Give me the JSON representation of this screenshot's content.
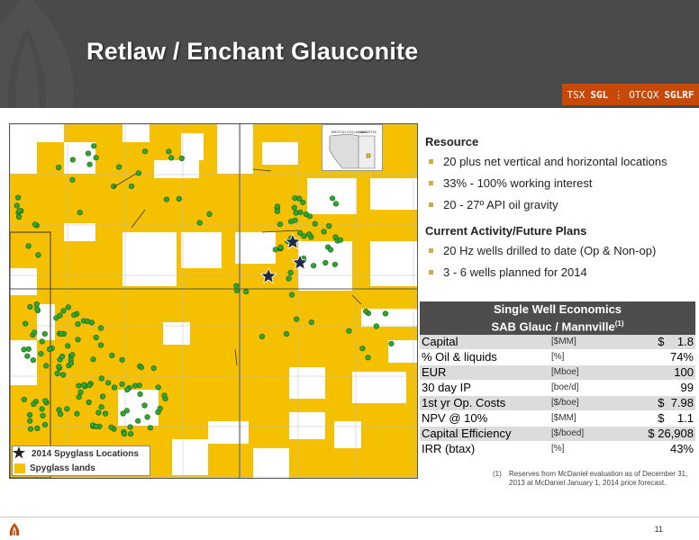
{
  "header": {
    "title": "Retlaw / Enchant Glauconite",
    "ticker": {
      "exchange1": "TSX",
      "symbol1": "SGL",
      "exchange2": "OTCQX",
      "symbol2": "SGLRF"
    }
  },
  "colors": {
    "accent": "#c6490a",
    "header_bg": "#4a4a4a",
    "land": "#f5c000",
    "well": "#2da82d",
    "bullet": "#d4a843"
  },
  "map": {
    "inset_labels": [
      "BRITISH COLUMBIA",
      "ALBERTA"
    ],
    "legend": {
      "locations": "2014 Spyglass Locations",
      "lands": "Spyglass lands"
    }
  },
  "resource": {
    "heading": "Resource",
    "bullets": [
      "20 plus net vertical and horizontal locations",
      "33% - 100% working interest",
      "20 - 27º API oil gravity"
    ]
  },
  "activity": {
    "heading": "Current Activity/Future Plans",
    "bullets": [
      "20 Hz wells drilled to date (Op & Non-op)",
      "3 - 6 wells planned for 2014"
    ]
  },
  "economics": {
    "title1": "Single Well Economics",
    "title2": "SAB Glauc / Mannville",
    "title_sup": "(1)",
    "rows": [
      {
        "label": "Capital",
        "unit": "[$MM]",
        "value": "$    1.8"
      },
      {
        "label": "% Oil & liquids",
        "unit": "[%]",
        "value": "74%"
      },
      {
        "label": "EUR",
        "unit": "[Mboe]",
        "value": "100"
      },
      {
        "label": "30 day IP",
        "unit": "[boe/d]",
        "value": "99"
      },
      {
        "label": "1st yr Op. Costs",
        "unit": "[$/boe]",
        "value": "$  7.98"
      },
      {
        "label": "NPV @ 10%",
        "unit": "[$MM]",
        "value": "$    1.1"
      },
      {
        "label": "Capital Efficiency",
        "unit": "[$/boed]",
        "value": "$ 26,908"
      },
      {
        "label": "IRR (btax)",
        "unit": "[%]",
        "value": "43%"
      }
    ]
  },
  "footnote": {
    "num": "(1)",
    "text": "Reserves from McDaniel evaluation as of December 31, 2013 at McDaniel January 1, 2014 price forecast."
  },
  "footer": {
    "page": "11"
  }
}
